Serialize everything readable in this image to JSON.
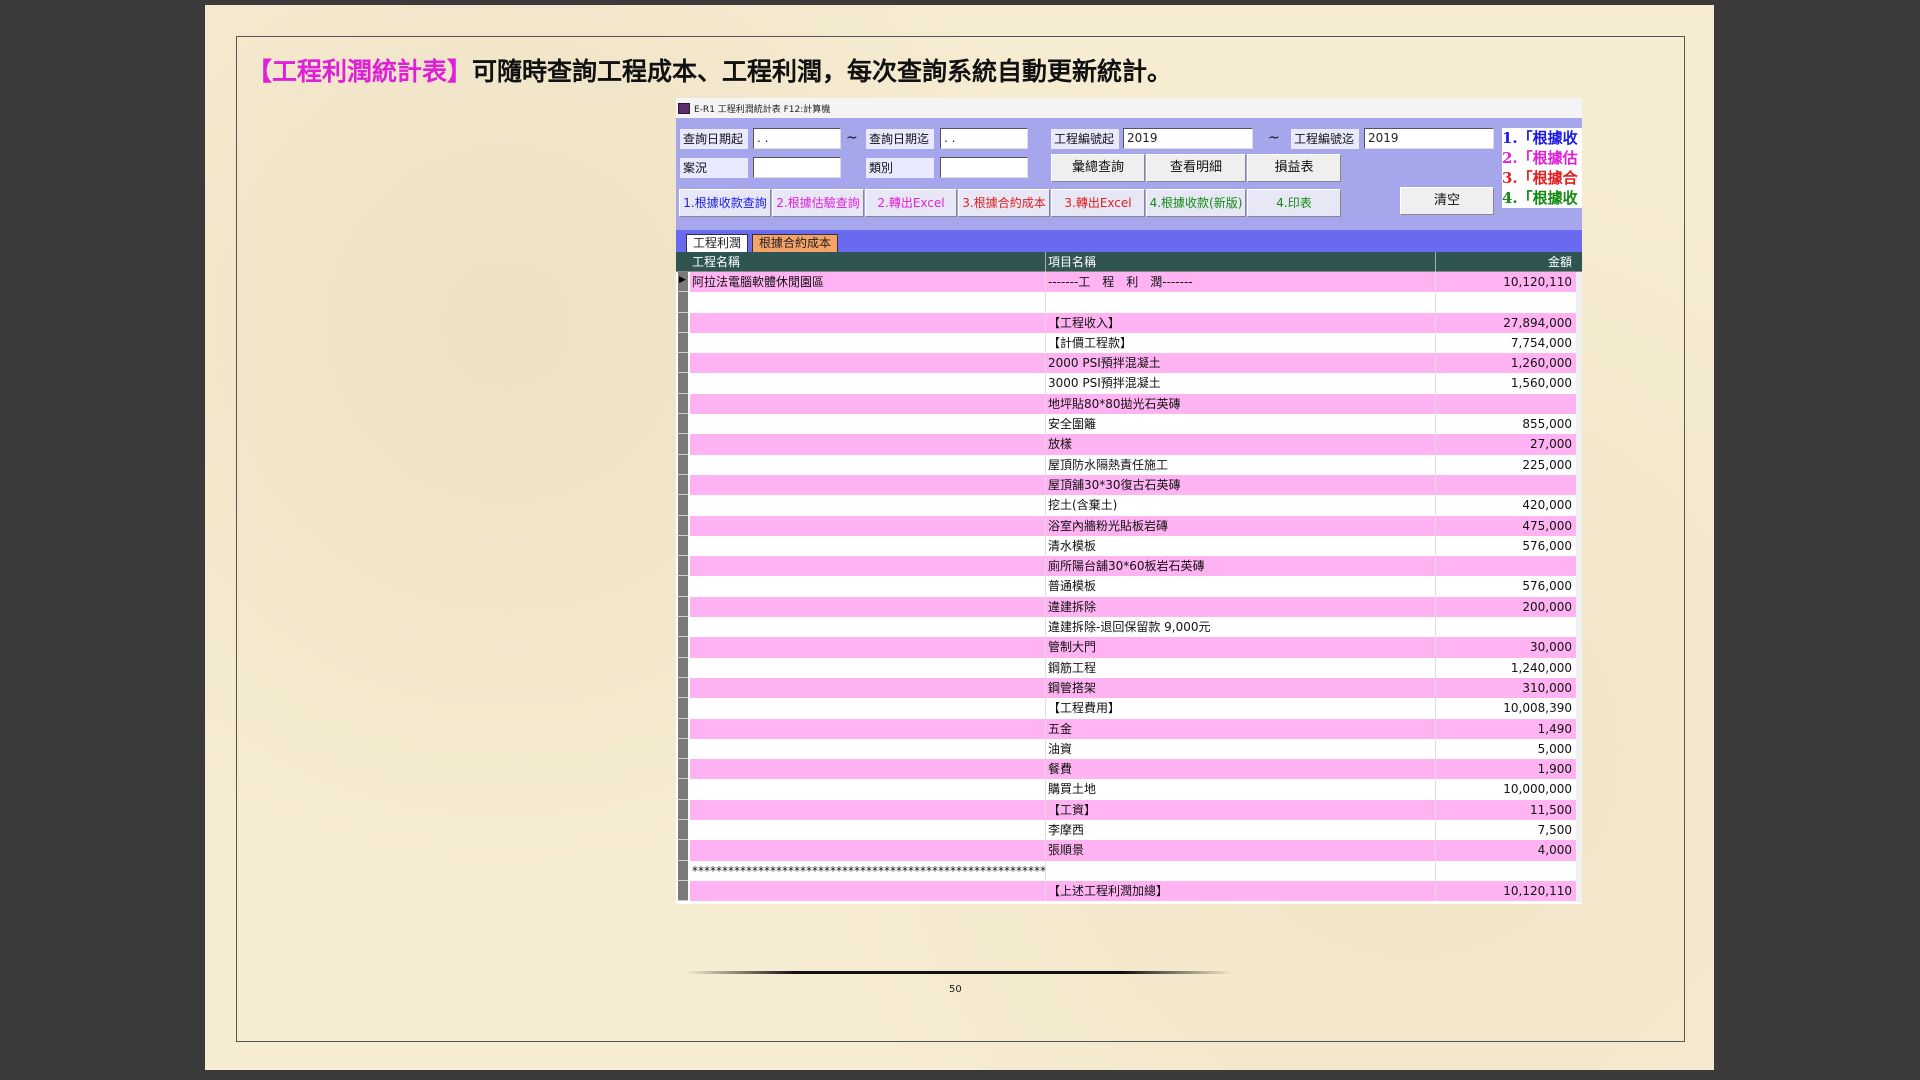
{
  "heading": {
    "highlight": "【工程利潤統計表】",
    "text": "可隨時查詢工程成本、工程利潤，每次查詢系統自動更新統計。"
  },
  "window": {
    "title": "E-R1 工程利潤統計表   F12:計算機"
  },
  "form": {
    "date_from_label": "查詢日期起",
    "date_from_value": " . .",
    "tilde": "~",
    "date_to_label": "查詢日期迄",
    "date_to_value": " . .",
    "project_from_label": "工程編號起",
    "project_from_value": "2019",
    "project_to_label": "工程編號迄",
    "project_to_value": "2019",
    "case_label": "案況",
    "case_value": "",
    "category_label": "類別",
    "category_value": ""
  },
  "buttons": {
    "summary_query": "彙總查詢",
    "view_detail": "查看明細",
    "pnl": "損益表",
    "clear": "清空",
    "opt1": "1.根據收款查詢",
    "opt2": "2.根據估驗查詢",
    "opt3": "2.轉出Excel",
    "opt4": "3.根據合約成本",
    "opt5": "3.轉出Excel",
    "opt6": "4.根據收款(新版)",
    "opt7": "4.印表"
  },
  "notes": [
    {
      "text": "1.「根據收",
      "color": "#1a1ae6"
    },
    {
      "text": "2.「根據估",
      "color": "#e020d8"
    },
    {
      "text": "3.「根據合",
      "color": "#e02020"
    },
    {
      "text": "4.「根據收",
      "color": "#138a13"
    }
  ],
  "tabs": {
    "active": "工程利潤",
    "other": "根據合約成本"
  },
  "grid": {
    "headers": [
      "工程名稱",
      "項目名稱",
      "金額"
    ],
    "rows": [
      {
        "c1": "阿拉法電腦軟體休閒園區",
        "c2": "     -------工　程　利　潤-------",
        "c3": "10,120,110"
      },
      {
        "c1": "",
        "c2": "",
        "c3": ""
      },
      {
        "c1": "",
        "c2": "      【工程收入】",
        "c3": "27,894,000"
      },
      {
        "c1": "",
        "c2": "      【計價工程款】",
        "c3": "7,754,000"
      },
      {
        "c1": "",
        "c2": "2000 PSI預拌混凝土",
        "c3": "1,260,000"
      },
      {
        "c1": "",
        "c2": "3000 PSI預拌混凝土",
        "c3": "1,560,000"
      },
      {
        "c1": "",
        "c2": "地坪貼80*80拋光石英磚",
        "c3": ""
      },
      {
        "c1": "",
        "c2": "安全圍籬",
        "c3": "855,000"
      },
      {
        "c1": "",
        "c2": "放樣",
        "c3": "27,000"
      },
      {
        "c1": "",
        "c2": "屋頂防水隔熱責任施工",
        "c3": "225,000"
      },
      {
        "c1": "",
        "c2": "屋頂舖30*30復古石英磚",
        "c3": ""
      },
      {
        "c1": "",
        "c2": "挖土(含棄土)",
        "c3": "420,000"
      },
      {
        "c1": "",
        "c2": "浴室內牆粉光貼板岩磚",
        "c3": "475,000"
      },
      {
        "c1": "",
        "c2": "清水模板",
        "c3": "576,000"
      },
      {
        "c1": "",
        "c2": "廁所陽台舖30*60板岩石英磚",
        "c3": ""
      },
      {
        "c1": "",
        "c2": "普通模板",
        "c3": "576,000"
      },
      {
        "c1": "",
        "c2": "違建拆除",
        "c3": "200,000"
      },
      {
        "c1": "",
        "c2": "違建拆除-退回保留款 9,000元",
        "c3": ""
      },
      {
        "c1": "",
        "c2": "管制大門",
        "c3": "30,000"
      },
      {
        "c1": "",
        "c2": "鋼筋工程",
        "c3": "1,240,000"
      },
      {
        "c1": "",
        "c2": "鋼管搭架",
        "c3": "310,000"
      },
      {
        "c1": "",
        "c2": "      【工程費用】",
        "c3": "10,008,390"
      },
      {
        "c1": "",
        "c2": "五金",
        "c3": "1,490"
      },
      {
        "c1": "",
        "c2": "油資",
        "c3": "5,000"
      },
      {
        "c1": "",
        "c2": "餐費",
        "c3": "1,900"
      },
      {
        "c1": "",
        "c2": "購買土地",
        "c3": "10,000,000"
      },
      {
        "c1": "",
        "c2": "      【工資】",
        "c3": "11,500"
      },
      {
        "c1": "",
        "c2": "李摩西",
        "c3": "7,500"
      },
      {
        "c1": "",
        "c2": "張順景",
        "c3": "4,000"
      },
      {
        "c1": "**********************************************************************************************",
        "c2": "",
        "c3": ""
      },
      {
        "c1": "",
        "c2": "  【上述工程利潤加總】",
        "c3": "10,120,110"
      }
    ]
  },
  "page_number": "50"
}
